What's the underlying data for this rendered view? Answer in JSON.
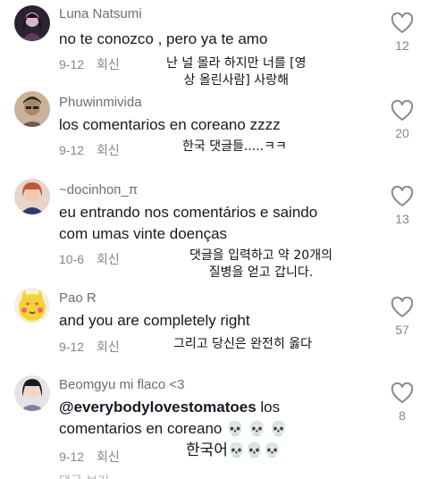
{
  "comments": [
    {
      "username": "Luna Natsumi",
      "text": "no te conozco , pero ya te amo",
      "date": "9-12",
      "reply": "회신",
      "caption_1": "난 널 몰라 하지만 너를 [영",
      "caption_2": "상 올린사람] 사랑해",
      "likes": "12"
    },
    {
      "username": "Phuwinmivida",
      "text": "los comentarios en coreano zzzz",
      "date": "9-12",
      "reply": "회신",
      "caption_1": "한국 댓글들.....ㅋㅋ",
      "likes": "20"
    },
    {
      "username": "~docinhoп_π",
      "text_1": "eu entrando nos comentários e saindo",
      "text_2": "com umas vinte doenças",
      "date": "10-6",
      "reply": "회신",
      "caption_1": "댓글을 입력하고 약 20개의",
      "caption_2": "질병을 얻고 갑니다.",
      "likes": "13"
    },
    {
      "username": "Pao R",
      "text": "and you are completely right",
      "date": "9-12",
      "reply": "회신",
      "caption_1": "그리고 당신은 완전히 옳다",
      "likes": "57"
    },
    {
      "username": "Beomgyu mi flaco <3",
      "mention": "@everybodylovestomatoes",
      "text_1": " los",
      "text_2": "comentarios en coreano",
      "skulls": "💀 💀 💀",
      "date": "9-12",
      "reply": "회신",
      "caption_1": "한국어",
      "caption_skulls": "💀💀💀",
      "likes": "8"
    }
  ],
  "cut_off_text": "댓글 보기",
  "icons": {
    "heart": "heart-outline-icon"
  }
}
